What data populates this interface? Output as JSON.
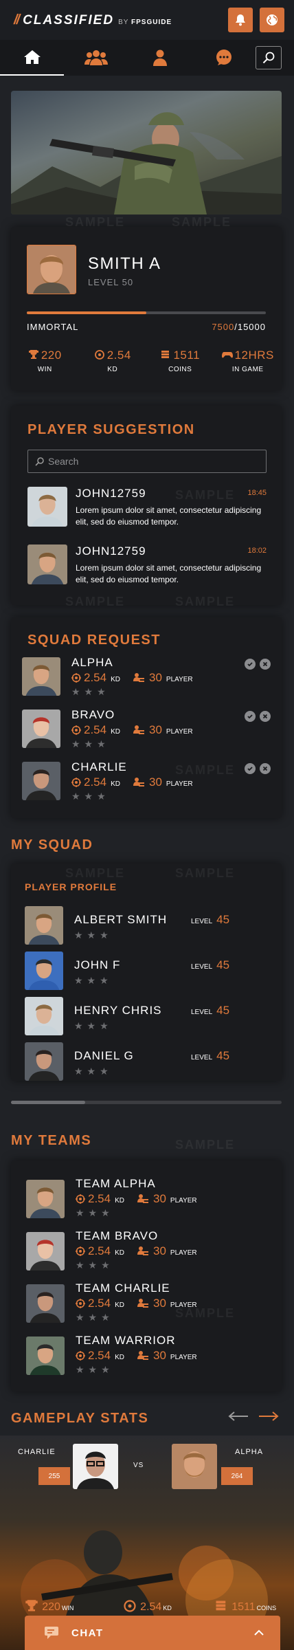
{
  "header": {
    "brand_prefix": "//",
    "brand": "CLASSIFIED",
    "by": "BY",
    "by_brand": "FPSGUIDE"
  },
  "nav": {
    "tabs": [
      "home-icon",
      "users-icon",
      "user-icon",
      "chat-icon"
    ],
    "search_icon": "search-icon"
  },
  "profile": {
    "name": "SMITH A",
    "level": "LEVEL 50",
    "rank": "IMMORTAL",
    "xp_current": "7500",
    "xp_total": "/15000",
    "xp_fraction": 0.5,
    "stats": [
      {
        "value": "220",
        "label": "WIN",
        "icon": "trophy-icon"
      },
      {
        "value": "2.54",
        "label": "KD",
        "icon": "crosshair-icon"
      },
      {
        "value": "1511",
        "label": "COINS",
        "icon": "coins-icon"
      },
      {
        "value": "12HRS",
        "label": "IN GAME",
        "icon": "gamepad-icon"
      }
    ]
  },
  "suggestions": {
    "title": "PLAYER SUGGESTION",
    "search_placeholder": "Search",
    "items": [
      {
        "name": "JOHN12759",
        "time": "18:45",
        "text": "Lorem ipsum dolor sit amet, consectetur adipiscing elit, sed do eiusmod tempor."
      },
      {
        "name": "JOHN12759",
        "time": "18:02",
        "text": "Lorem ipsum dolor sit amet, consectetur adipiscing elit, sed do eiusmod tempor."
      }
    ]
  },
  "squad_request": {
    "title": "SQUAD REQUEST",
    "kd_label": "KD",
    "player_label": "PLAYER",
    "items": [
      {
        "name": "ALPHA",
        "kd": "2.54",
        "players": "30"
      },
      {
        "name": "BRAVO",
        "kd": "2.54",
        "players": "30"
      },
      {
        "name": "CHARLIE",
        "kd": "2.54",
        "players": "30"
      }
    ]
  },
  "my_squad": {
    "title": "MY SQUAD",
    "subtitle": "PLAYER PROFILE",
    "level_label": "LEVEL",
    "members": [
      {
        "name": "ALBERT SMITH",
        "level": "45"
      },
      {
        "name": "JOHN F",
        "level": "45"
      },
      {
        "name": "HENRY CHRIS",
        "level": "45"
      },
      {
        "name": "DANIEL G",
        "level": "45"
      }
    ]
  },
  "my_teams": {
    "title": "MY TEAMS",
    "kd_label": "KD",
    "player_label": "PLAYER",
    "teams": [
      {
        "name": "TEAM ALPHA",
        "kd": "2.54",
        "players": "30"
      },
      {
        "name": "TEAM BRAVO",
        "kd": "2.54",
        "players": "30"
      },
      {
        "name": "TEAM CHARLIE",
        "kd": "2.54",
        "players": "30"
      },
      {
        "name": "TEAM WARRIOR",
        "kd": "2.54",
        "players": "30"
      }
    ]
  },
  "gameplay": {
    "title": "GAMEPLAY STATS",
    "left_name": "CHARLIE",
    "left_score": "255",
    "vs": "VS",
    "right_name": "ALPHA",
    "right_score": "264",
    "stats": [
      {
        "value": "220",
        "label": "WIN"
      },
      {
        "value": "2.54",
        "label": "KD"
      },
      {
        "value": "1511",
        "label": "COINS"
      }
    ]
  },
  "chat": {
    "label": "CHAT"
  },
  "watermark": "SAMPLE",
  "colors": {
    "accent": "#e07a3c",
    "background": "#202226",
    "card": "#1a1b1e"
  }
}
